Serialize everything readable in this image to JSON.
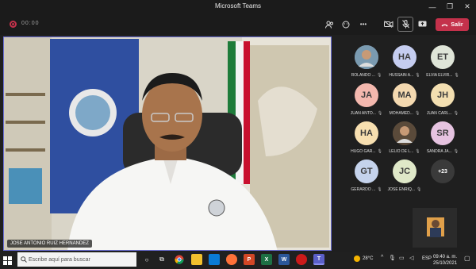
{
  "window": {
    "title": "Microsoft Teams",
    "minimize": "—",
    "maximize": "❐",
    "close": "✕"
  },
  "toolbar": {
    "timer": "00:00",
    "more": "•••",
    "leave_label": "Salir"
  },
  "stage": {
    "speaker_name": "JOSE ANTONIO RUIZ HERNANDEZ"
  },
  "participants": [
    {
      "initials": "",
      "name": "ROLANDO ...",
      "color": "#7a9ab0",
      "photo": true
    },
    {
      "initials": "HA",
      "name": "HUSSAIN A...",
      "color": "#c5cdf0"
    },
    {
      "initials": "ET",
      "name": "ELVIA ELVIR...",
      "color": "#dfe5d8"
    },
    {
      "initials": "JA",
      "name": "JUAN ANTO...",
      "color": "#f4b8ae"
    },
    {
      "initials": "MA",
      "name": "MOHAMED...",
      "color": "#f4d9b0"
    },
    {
      "initials": "JH",
      "name": "JUAN CARL...",
      "color": "#f3dfb1"
    },
    {
      "initials": "HA",
      "name": "HUGO GAR...",
      "color": "#f7dfb0"
    },
    {
      "initials": "",
      "name": "LELIO DE L...",
      "color": "#5a4a3a",
      "photo": true
    },
    {
      "initials": "SR",
      "name": "SANDRA JA...",
      "color": "#e6c3e0"
    },
    {
      "initials": "GT",
      "name": "GERARDO ...",
      "color": "#c5d3ec"
    },
    {
      "initials": "JC",
      "name": "JOSE ENRIQ...",
      "color": "#dfe8c8"
    },
    {
      "initials": "+23",
      "name": "",
      "color": "#3a3a3a",
      "overflow": true
    }
  ],
  "taskbar": {
    "search_placeholder": "Escribe aquí para buscar",
    "temperature": "28°C",
    "language": "ESP",
    "time": "09:40 a. m.",
    "date": "25/10/2021"
  },
  "colors": {
    "accent": "#6b6fd6",
    "leave": "#c4314b",
    "taskbar": "#202020"
  }
}
